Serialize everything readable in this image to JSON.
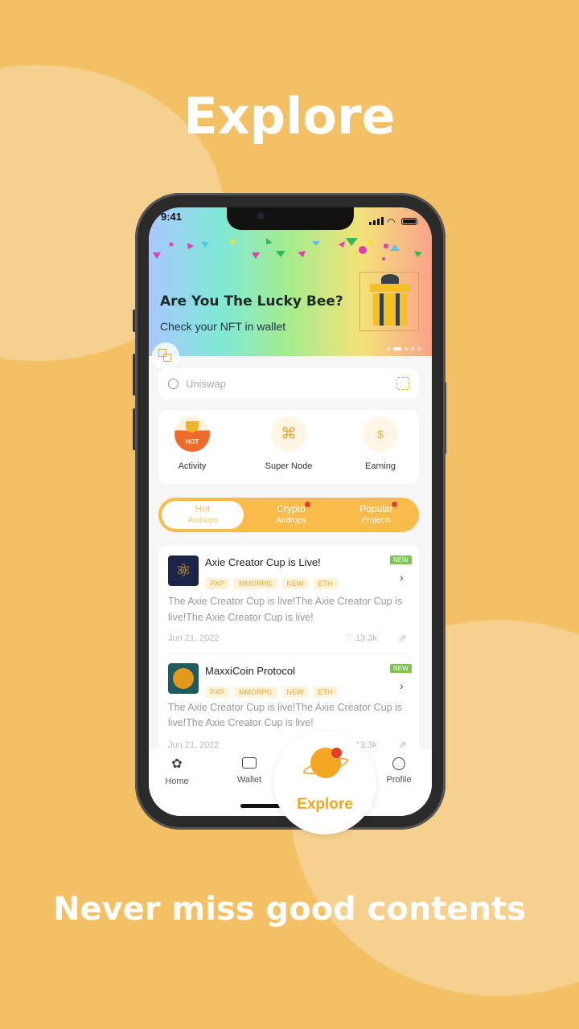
{
  "headline": "Explore",
  "tagline": "Never miss good contents",
  "status": {
    "time": "9:41"
  },
  "banner": {
    "title": "Are You The Lucky Bee?",
    "subtitle": "Check your NFT in wallet"
  },
  "search": {
    "placeholder": "Uniswap"
  },
  "quick_actions": [
    {
      "label": "Activity",
      "badge": "HOT"
    },
    {
      "label": "Super Node"
    },
    {
      "label": "Earning"
    }
  ],
  "tabs": [
    {
      "title": "Hot",
      "sub": "Airdrops",
      "active": true
    },
    {
      "title": "Crypto",
      "sub": "Airdrops",
      "dot": true
    },
    {
      "title": "Popular",
      "sub": "Projects",
      "dot": true
    }
  ],
  "posts": [
    {
      "title": "Axie Creator Cup is Live!",
      "badge": "NEW",
      "tags": [
        "PXP",
        "MMORPG",
        "NEW",
        "ETH"
      ],
      "desc": "The Axie Creator Cup is live!The Axie Creator Cup is live!The Axie Creator Cup is live!",
      "date": "Jun 21, 2022",
      "likes": "13.3k"
    },
    {
      "title": "MaxxiCoin Protocol",
      "badge": "NEW",
      "tags": [
        "PXP",
        "MMORPG",
        "NEW",
        "ETH"
      ],
      "desc": "The Axie Creator Cup is live!The Axie Creator Cup is live!The Axie Creator Cup is live!",
      "date": "Jun 21, 2022",
      "likes": "13.3k"
    }
  ],
  "nav": [
    {
      "label": "Home"
    },
    {
      "label": "Wallet"
    },
    {
      "label": "Explore",
      "active": true
    },
    {
      "label": "Profile"
    }
  ],
  "colors": {
    "background": "#F3C066",
    "accent": "#F5A623",
    "badge_new": "#7BC453",
    "dot": "#E0402F"
  }
}
